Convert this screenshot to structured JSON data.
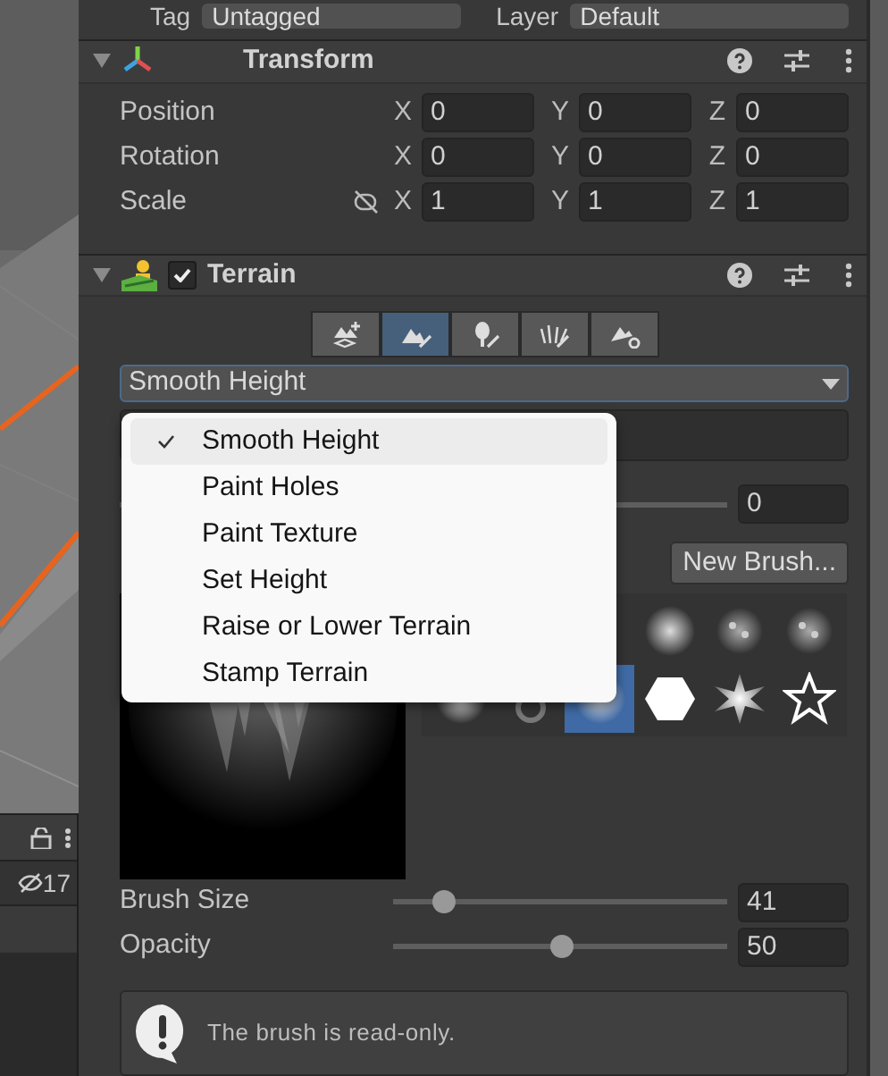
{
  "scene_strip": {
    "hidden_count": "17"
  },
  "tag_row": {
    "tag_label": "Tag",
    "tag_value": "Untagged",
    "layer_label": "Layer",
    "layer_value": "Default"
  },
  "transform": {
    "title": "Transform",
    "expanded": true,
    "rows": [
      {
        "label": "Position",
        "kind": "vector",
        "axes": [
          {
            "axis": "X",
            "value": "0"
          },
          {
            "axis": "Y",
            "value": "0"
          },
          {
            "axis": "Z",
            "value": "0"
          }
        ]
      },
      {
        "label": "Rotation",
        "kind": "vector",
        "axes": [
          {
            "axis": "X",
            "value": "0"
          },
          {
            "axis": "Y",
            "value": "0"
          },
          {
            "axis": "Z",
            "value": "0"
          }
        ]
      },
      {
        "label": "Scale",
        "kind": "scale",
        "axes": [
          {
            "axis": "X",
            "value": "1"
          },
          {
            "axis": "Y",
            "value": "1"
          },
          {
            "axis": "Z",
            "value": "1"
          }
        ]
      }
    ]
  },
  "terrain": {
    "title": "Terrain",
    "expanded": true,
    "enabled": true,
    "tools": [
      {
        "kind": "create",
        "selected": false
      },
      {
        "kind": "paint",
        "selected": true
      },
      {
        "kind": "trees",
        "selected": false
      },
      {
        "kind": "details",
        "selected": false
      },
      {
        "kind": "settings",
        "selected": false
      }
    ],
    "mode_dropdown": {
      "value": "Smooth Height"
    },
    "mode_menu": [
      {
        "label": "Smooth Height",
        "checked": true,
        "selected": true
      },
      {
        "label": "Paint Holes",
        "checked": false,
        "selected": false
      },
      {
        "label": "Paint Texture",
        "checked": false,
        "selected": false
      },
      {
        "label": "Set Height",
        "checked": false,
        "selected": false
      },
      {
        "label": "Raise or Lower Terrain",
        "checked": false,
        "selected": false
      },
      {
        "label": "Stamp Terrain",
        "checked": false,
        "selected": false
      }
    ],
    "slider_value": "0",
    "new_brush_button": "New Brush...",
    "brushes": [
      {
        "kind": "soft",
        "selected": false
      },
      {
        "kind": "speckle",
        "selected": false
      },
      {
        "kind": "speckle",
        "selected": false
      },
      {
        "kind": "soft",
        "selected": false
      },
      {
        "kind": "ring",
        "selected": false
      },
      {
        "kind": "soft",
        "selected": true
      },
      {
        "kind": "hexagon",
        "selected": false
      },
      {
        "kind": "burst",
        "selected": false
      },
      {
        "kind": "star",
        "selected": false
      }
    ],
    "brush_size": {
      "label": "Brush Size",
      "level": 0.15,
      "value": "41"
    },
    "opacity": {
      "label": "Opacity",
      "level": 0.5,
      "value": "50"
    },
    "help_box": {
      "text": "The brush is read-only."
    }
  }
}
